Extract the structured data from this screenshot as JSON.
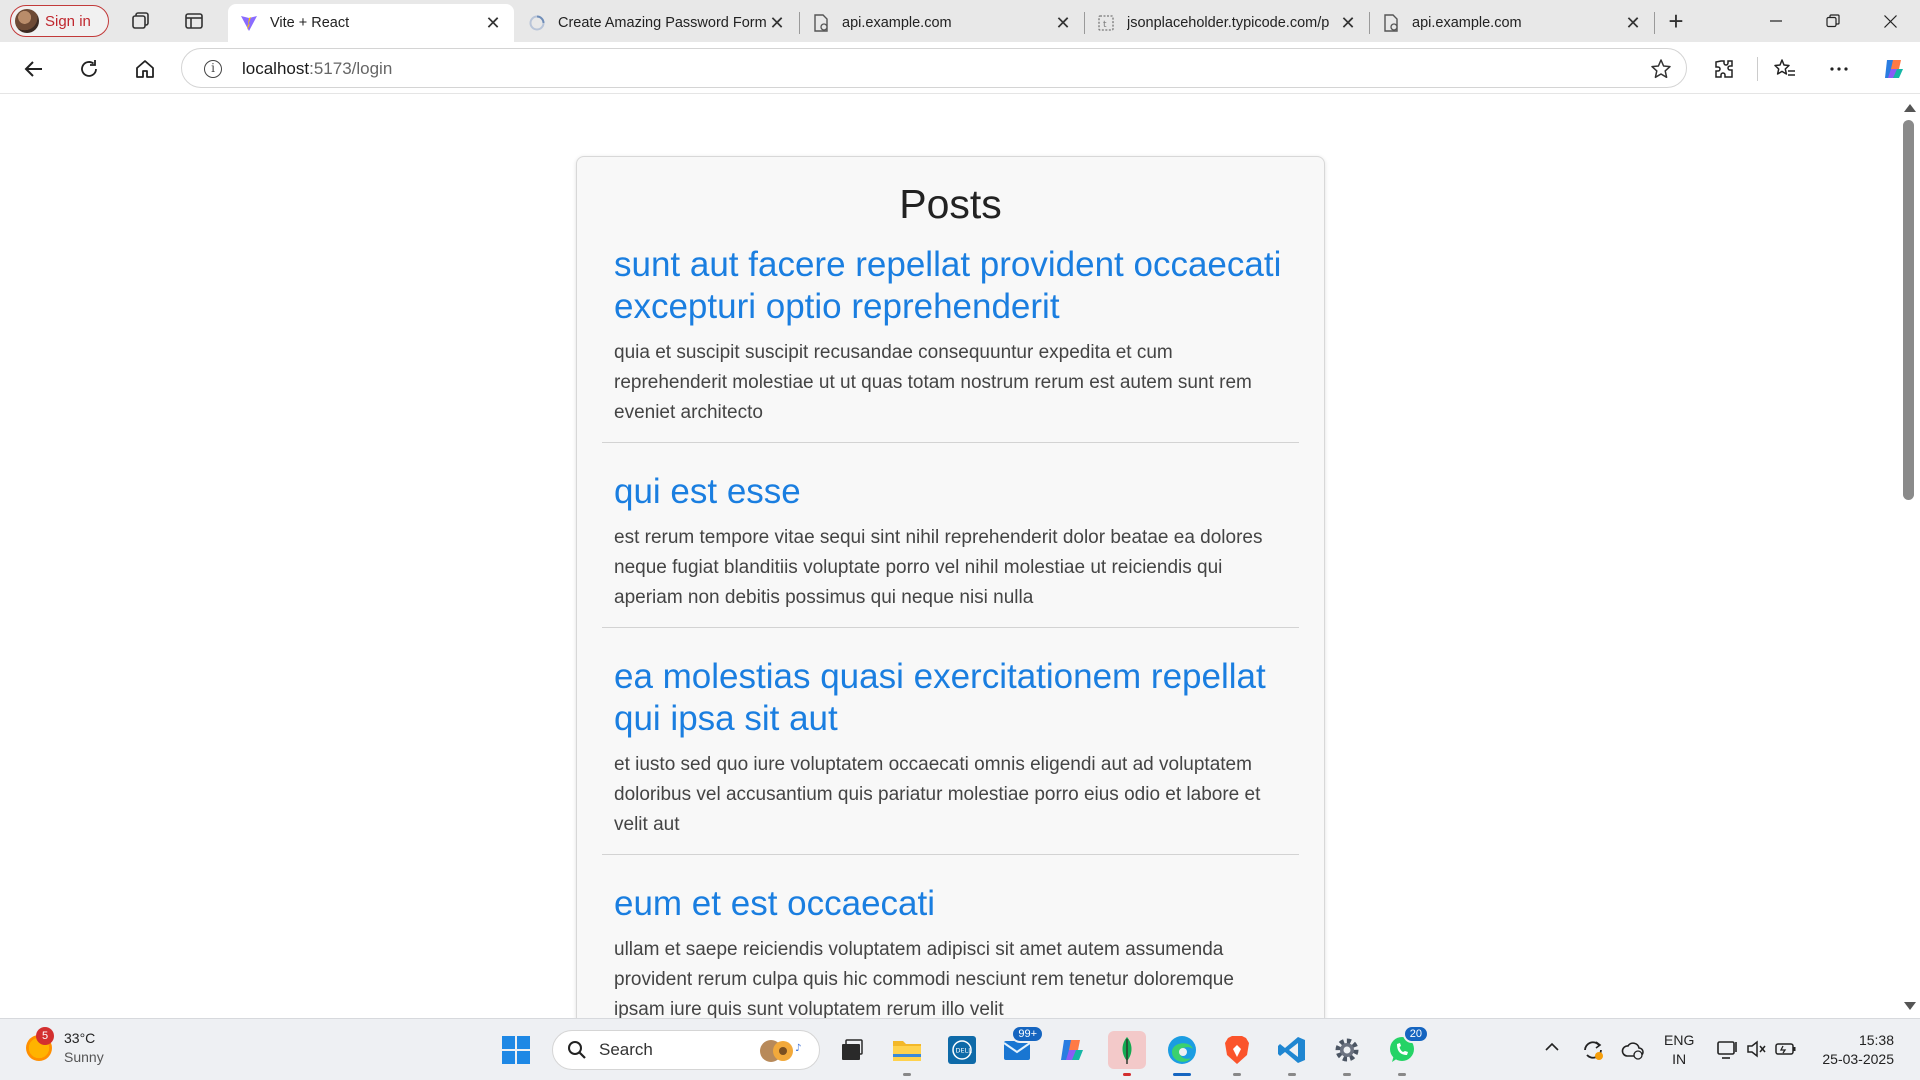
{
  "browser": {
    "signin_label": "Sign in",
    "tabs": [
      {
        "title": "Vite + React",
        "icon": "vite-icon",
        "active": true
      },
      {
        "title": "Create Amazing Password Form",
        "icon": "loading-icon",
        "active": false
      },
      {
        "title": "api.example.com",
        "icon": "page-icon",
        "active": false
      },
      {
        "title": "jsonplaceholder.typicode.com/p",
        "icon": "page-icon",
        "active": false
      },
      {
        "title": "api.example.com",
        "icon": "page-icon",
        "active": false
      }
    ],
    "close_glyph": "✕",
    "new_tab_glyph": "+",
    "url_host": "localhost",
    "url_rest": ":5173/login"
  },
  "page": {
    "heading": "Posts",
    "posts": [
      {
        "title": "sunt aut facere repellat provident occaecati excepturi optio reprehenderit",
        "body": "quia et suscipit suscipit recusandae consequuntur expedita et cum reprehenderit molestiae ut ut quas totam nostrum rerum est autem sunt rem eveniet architecto"
      },
      {
        "title": "qui est esse",
        "body": "est rerum tempore vitae sequi sint nihil reprehenderit dolor beatae ea dolores neque fugiat blanditiis voluptate porro vel nihil molestiae ut reiciendis qui aperiam non debitis possimus qui neque nisi nulla"
      },
      {
        "title": "ea molestias quasi exercitationem repellat qui ipsa sit aut",
        "body": "et iusto sed quo iure voluptatem occaecati omnis eligendi aut ad voluptatem doloribus vel accusantium quis pariatur molestiae porro eius odio et labore et velit aut"
      },
      {
        "title": "eum et est occaecati",
        "body": "ullam et saepe reiciendis voluptatem adipisci sit amet autem assumenda provident rerum culpa quis hic commodi nesciunt rem tenetur doloremque ipsam iure quis sunt voluptatem rerum illo velit"
      }
    ]
  },
  "taskbar": {
    "weather_badge": "5",
    "temperature": "33°C",
    "condition": "Sunny",
    "search_label": "Search",
    "mail_count": "99+",
    "whatsapp_count": "20",
    "language": "ENG",
    "region": "IN",
    "time": "15:38",
    "date": "25-03-2025"
  },
  "colors": {
    "link": "#1a7ee0",
    "accent": "#1565c0",
    "signin": "#c0282f"
  }
}
